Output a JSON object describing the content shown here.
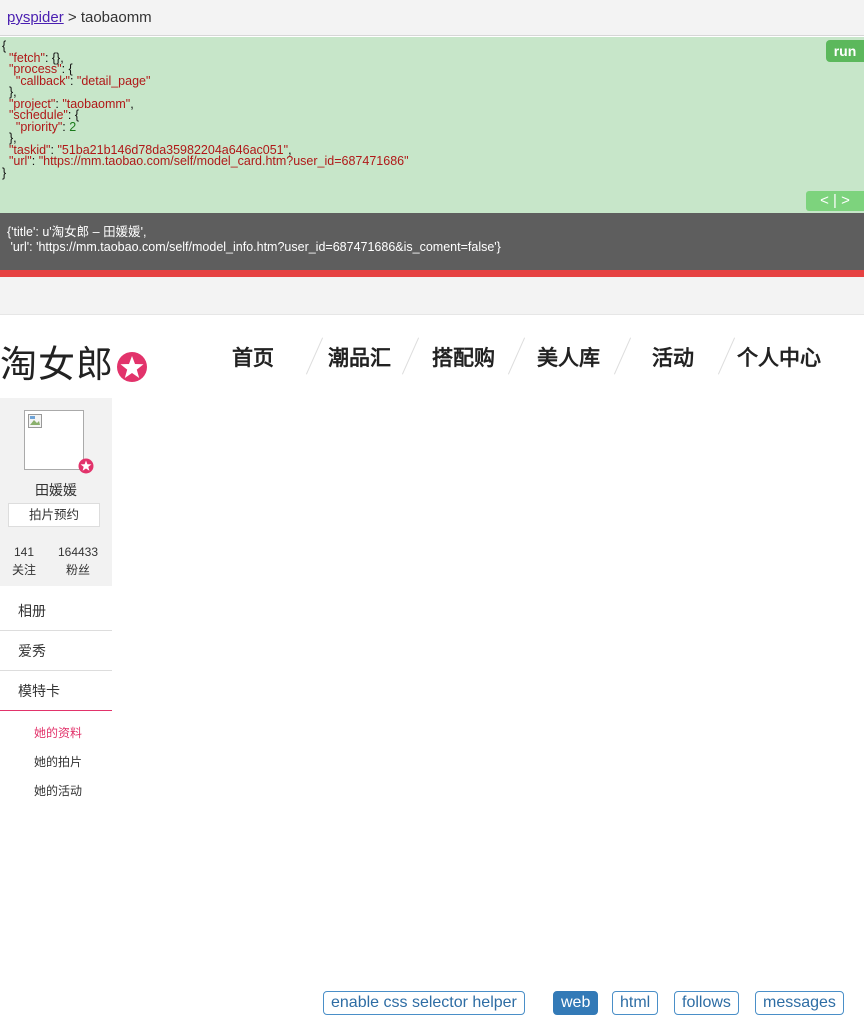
{
  "breadcrumb": {
    "root": "pyspider",
    "separator": " > ",
    "project": "taobaomm"
  },
  "task_panel": {
    "lines": [
      "{",
      "  \"fetch\": {},",
      "  \"process\": {",
      "    \"callback\": \"detail_page\"",
      "  },",
      "  \"project\": \"taobaomm\",",
      "  \"schedule\": {",
      "    \"priority\": 2",
      "  },",
      "  \"taskid\": \"51ba21b146d78da35982204a646ac051\",",
      "  \"url\": \"https://mm.taobao.com/self/model_card.htm?user_id=687471686\"",
      "}"
    ],
    "run_label": "run",
    "nav_label": "< | >"
  },
  "result": {
    "line1": "{'title': u'淘女郎 – 田媛媛',",
    "line2": " 'url': 'https://mm.taobao.com/self/model_info.htm?user_id=687471686&is_coment=false'}"
  },
  "site": {
    "logo_text": "淘女郎",
    "nav": [
      "首页",
      "潮品汇",
      "搭配购",
      "美人库",
      "活动",
      "个人中心"
    ]
  },
  "profile": {
    "name": "田媛媛",
    "book_button": "拍片预约",
    "follow_count": "141",
    "follow_label": "关注",
    "fans_count": "164433",
    "fans_label": "粉丝"
  },
  "sidebar_menu": [
    "相册",
    "爱秀",
    "模特卡"
  ],
  "sidebar_sub": [
    "她的资料",
    "她的拍片",
    "她的活动"
  ],
  "toolbar": {
    "css_helper": "enable css selector helper",
    "web": "web",
    "html": "html",
    "follows": "follows",
    "messages": "messages"
  },
  "colors": {
    "accent_pink": "#e2336b",
    "run_green": "#5cb85c",
    "task_bg": "#c7e6c9",
    "active_tab": "#337ab7"
  }
}
